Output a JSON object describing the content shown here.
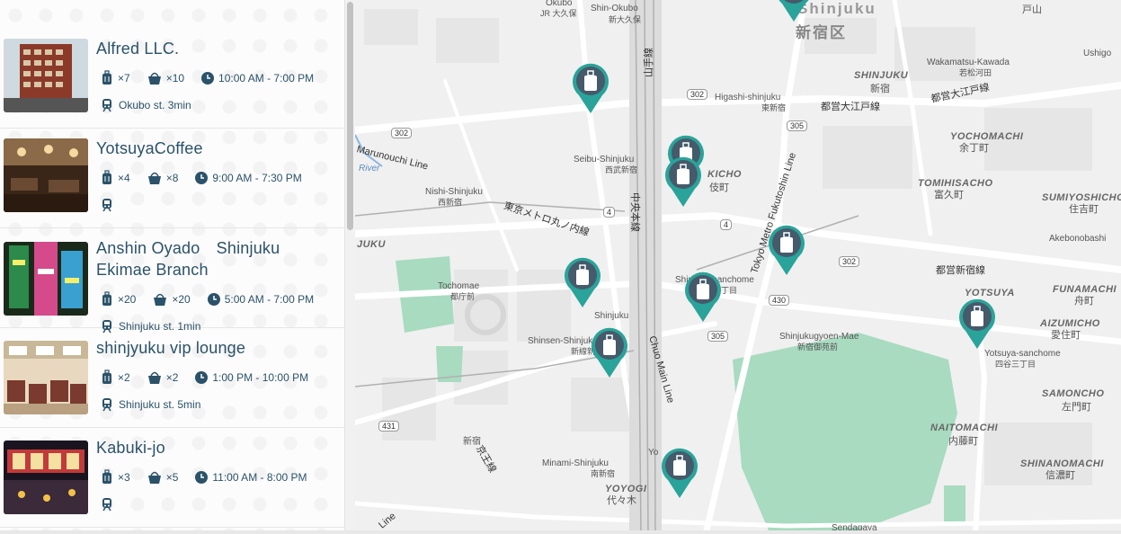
{
  "listings": [
    {
      "name": "Alfred LLC.",
      "suitcases": "×7",
      "bags": "×10",
      "hours": "10:00 AM - 7:00 PM",
      "station": "Okubo st. 3min",
      "thumb_color": "#8b3a2a"
    },
    {
      "name": "YotsuyaCoffee",
      "suitcases": "×4",
      "bags": "×8",
      "hours": "9:00 AM - 7:30 PM",
      "station": "",
      "thumb_color": "#6a4a32"
    },
    {
      "name": "Anshin Oyado　Shinjuku Ekimae Branch",
      "suitcases": "×20",
      "bags": "×20",
      "hours": "5:00 AM - 7:00 PM",
      "station": "Shinjuku st. 1min",
      "thumb_color": "#2c8a4a"
    },
    {
      "name": "shinjyuku vip lounge",
      "suitcases": "×2",
      "bags": "×2",
      "hours": "1:00 PM - 10:00 PM",
      "station": "Shinjuku st. 5min",
      "thumb_color": "#7a3a2e"
    },
    {
      "name": "Kabuki-jo",
      "suitcases": "×3",
      "bags": "×5",
      "hours": "11:00 AM - 8:00 PM",
      "station": "",
      "thumb_color": "#3a2a3a"
    }
  ],
  "icons": {
    "suitcase": "suitcase-icon",
    "bag": "bag-icon",
    "clock": "clock-icon",
    "train": "train-icon",
    "pin": "luggage-pin-icon"
  },
  "colors": {
    "text": "#2b5269",
    "pin": "#2aa39a",
    "pin_inner": "#455a6a",
    "park": "#a8dbc0",
    "river": "#8bb5e0"
  },
  "map": {
    "labels": {
      "shinjuku_en": "Shinjuku",
      "shinjuku_ku": "新宿区",
      "shinjuku_area": "SHINJUKU",
      "shinjuku_area_jp": "新宿",
      "wakamatsu": "Wakamatsu-Kawada",
      "wakamatsu_jp": "若松河田",
      "yochomachi": "YOCHOMACHI",
      "yochomachi_jp": "余丁町",
      "tomihisacho": "TOMIHISACHO",
      "tomihisacho_jp": "富久町",
      "sumiyoshicho": "SUMIYOSHICHO",
      "sumiyoshicho_jp": "住吉町",
      "akebonobashi": "Akebonobashi",
      "yotsuya": "YOTSUYA",
      "funamachi": "FUNAMACHI",
      "funamachi_jp": "舟町",
      "aizumicho": "AIZUMICHO",
      "aizumicho_jp": "愛住町",
      "samoncho": "SAMONCHO",
      "samoncho_jp": "左門町",
      "naitomachi": "NAITOMACHI",
      "naitomachi_jp": "内藤町",
      "shinanomachi": "SHINANOMACHI",
      "shinanomachi_jp": "信濃町",
      "yotsuya_sanchome": "Yotsuya-sanchome",
      "yotsuya_sanchome_jp": "四谷三丁目",
      "shinjukugyoen": "Shinjukugyoen-Mae",
      "shinjukugyoen_jp": "新宿御苑前",
      "shinjuku_sanchome": "Shinjuku-sanchome",
      "shinjuku_sanchome_jp": "新宿三丁目",
      "higashi_shinjuku": "Higashi-shinjuku",
      "higashi_shinjuku_jp": "東新宿",
      "toei_oedo": "都営大江戸線",
      "toei_oedo2": "都営大江戸線",
      "toei_shinjuku": "都営新宿線",
      "seibu_shinjuku": "Seibu-Shinjuku",
      "seibu_shinjuku_jp": "西武新宿",
      "kabukicho": "KICHO",
      "kabukicho_jp": "伎町",
      "nishi_shinjuku": "Nishi-Shinjuku",
      "nishi_shinjuku_jp": "西新宿",
      "marunouchi": "Marunouchi Line",
      "marunouchi_jp": "東京メトロ丸ノ内線",
      "tochomae": "Tochomae",
      "tochomae_jp": "都庁前",
      "shinjuku_st": "Shinjuku",
      "shinsen_shinjuku": "Shinsen-Shinjuku",
      "shinsen_jp": "新線新宿",
      "chuo_main": "Chuo Main Line",
      "chuo_jp": "中央本線",
      "yamanote_jp": "山手線",
      "fukutoshin": "Tokyo Metro Fukutoshin Line",
      "minami_shinjuku": "Minami-Shinjuku",
      "minami_shinjuku_jp": "南新宿",
      "yoyogi": "YOYOGI",
      "yoyogi_jp": "代々木",
      "sendagaya": "Sendagaya",
      "river": "River",
      "juku": "JUKU",
      "okubo": "Okubo",
      "okubo_jp": "JR 大久保",
      "shin_okubo": "Shin-Okubo",
      "shin_okubo_jp": "新大久保",
      "kokyo_jp": "京王線",
      "shinjuku_jp_mark": "新宿",
      "toyama": "戸山",
      "ushigome": "Ushigo",
      "r302a": "302",
      "r302b": "302",
      "r302c": "302",
      "r305": "305",
      "r430": "430",
      "r431": "431",
      "r4a": "4",
      "r4b": "4",
      "yoyogi_short": "Yo",
      "line_short": "Line"
    }
  }
}
